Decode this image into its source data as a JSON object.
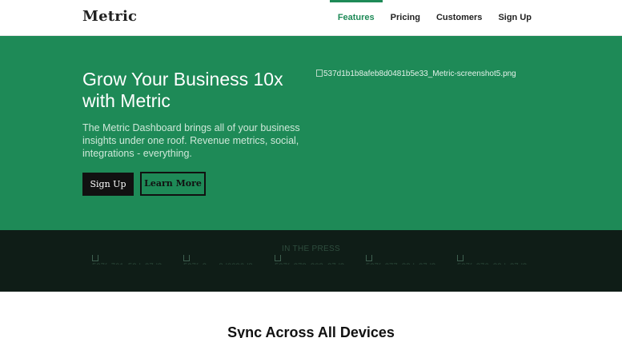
{
  "header": {
    "logo": "Metric",
    "nav": [
      {
        "label": "Features",
        "active": true
      },
      {
        "label": "Pricing",
        "active": false
      },
      {
        "label": "Customers",
        "active": false
      },
      {
        "label": "Sign Up",
        "active": false
      }
    ]
  },
  "hero": {
    "title": "Grow Your Business 10x with Metric",
    "text": "The Metric Dashboard brings all of your business insights under one roof. Revenue metrics, social, integrations - everything.",
    "signup_label": "Sign Up",
    "learn_more_label": "Learn More",
    "image_alt": "537d1b1b8afeb8d0481b5e33_Metric-screenshot5.png"
  },
  "press": {
    "title": "IN THE PRESS",
    "logos": [
      "537fa761e52da27d3",
      "537fe2eec3d0096d3",
      "537fe278e808e27d3",
      "537fe277a82da27d3",
      "537fe276e83da27d3"
    ]
  },
  "sync": {
    "title": "Sync Across All Devices"
  },
  "colors": {
    "brand_green": "#1e8a57",
    "press_bg": "#0f1d17",
    "button_dark": "#111111"
  }
}
